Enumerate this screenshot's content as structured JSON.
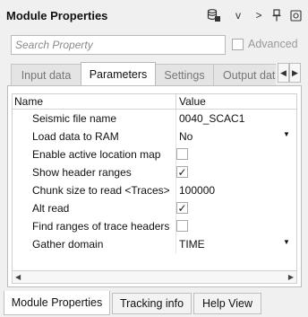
{
  "header": {
    "title": "Module Properties"
  },
  "toolbar": {
    "icons": [
      "database-icon",
      "chevron-down-icon",
      "chevron-right-icon",
      "pin-icon",
      "popout-icon"
    ],
    "chevron_down": "v",
    "chevron_right": ">"
  },
  "search": {
    "placeholder": "Search Property",
    "value": ""
  },
  "advanced": {
    "label": "Advanced",
    "checked": false
  },
  "tabs": [
    {
      "label": "Input data"
    },
    {
      "label": "Parameters",
      "active": true
    },
    {
      "label": "Settings"
    },
    {
      "label": "Output data"
    }
  ],
  "grid": {
    "columns": {
      "name": "Name",
      "value": "Value"
    },
    "rows": [
      {
        "name": "Seismic file name",
        "value": "0040_SCAC1"
      },
      {
        "name": "Load data to RAM",
        "value": "No"
      },
      {
        "name": "Enable active location map",
        "checked": false
      },
      {
        "name": "Show header ranges",
        "checked": true
      },
      {
        "name": "Chunk size to read <Traces>",
        "value": "100000"
      },
      {
        "name": "Alt read",
        "checked": true
      },
      {
        "name": "Find ranges of trace headers",
        "checked": false
      },
      {
        "name": "Gather domain",
        "value": "TIME"
      }
    ]
  },
  "bottom_tabs": [
    {
      "label": "Module Properties",
      "active": true
    },
    {
      "label": "Tracking info"
    },
    {
      "label": "Help View"
    }
  ],
  "glyphs": {
    "check": "✓",
    "dropdown": "▼",
    "left": "◀",
    "right": "▶"
  }
}
